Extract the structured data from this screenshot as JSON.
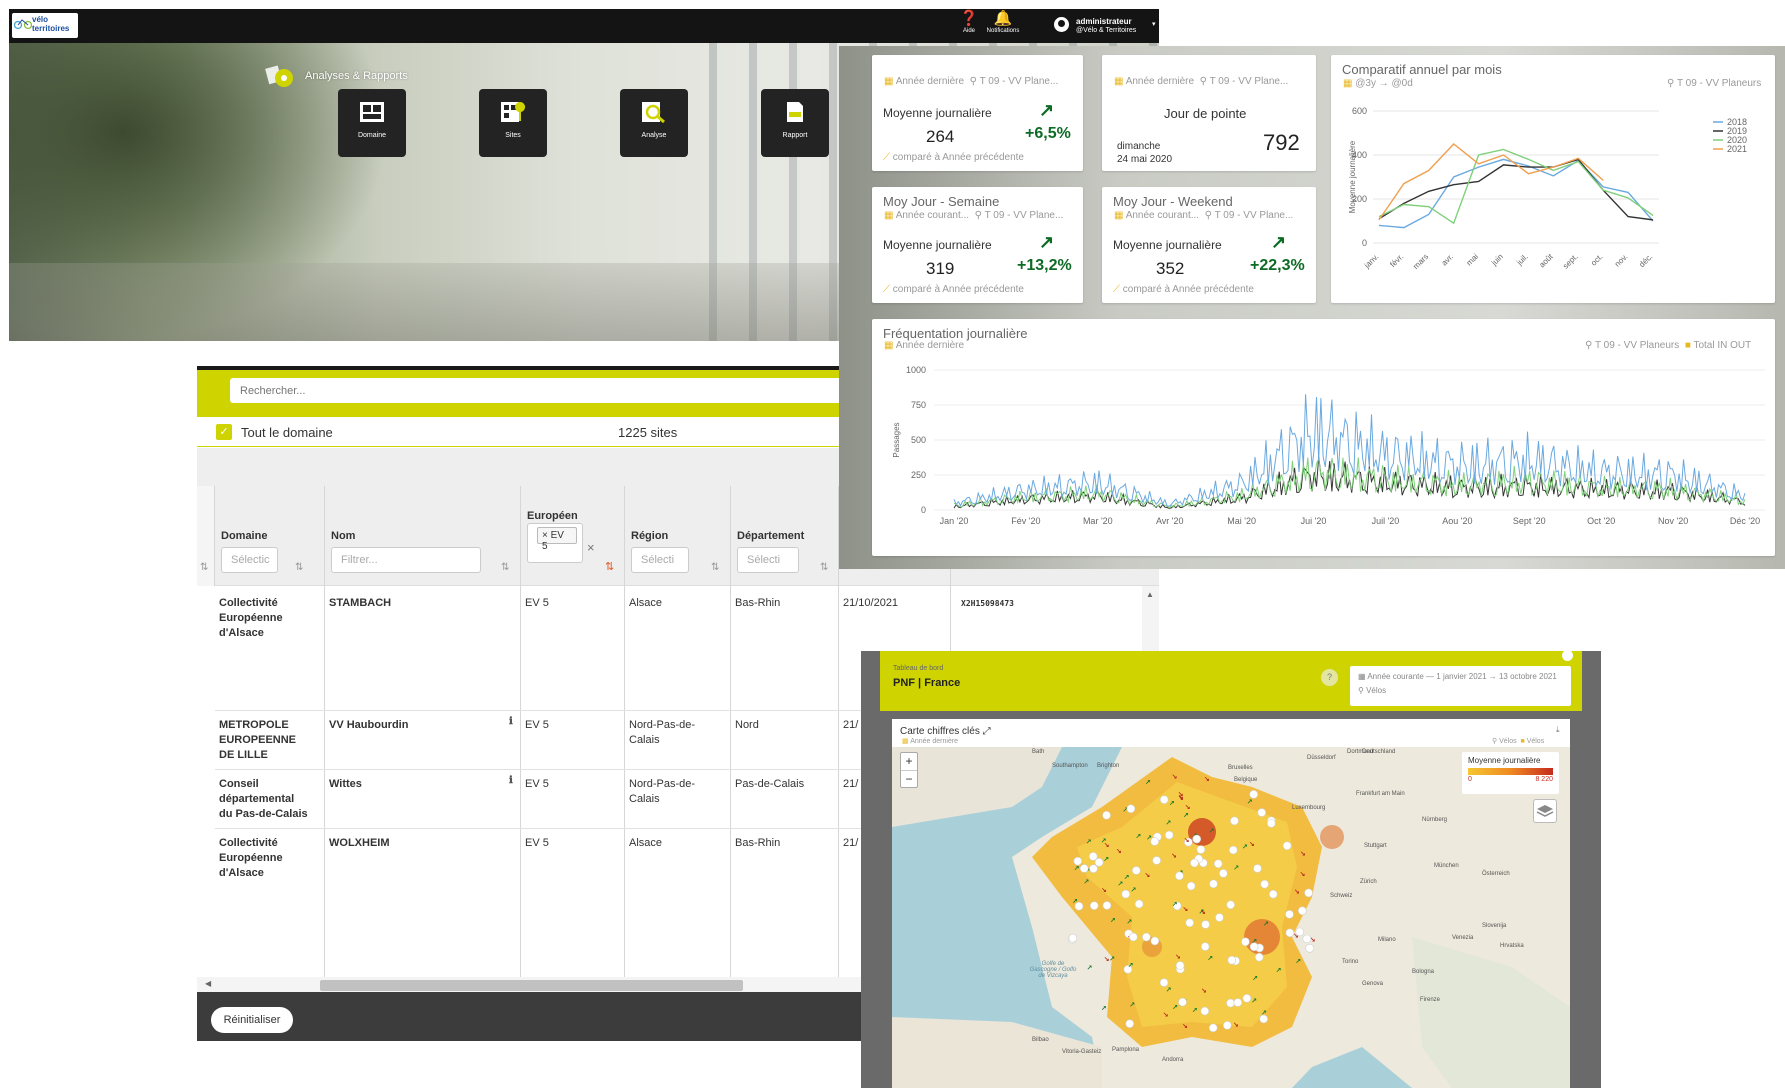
{
  "header": {
    "logo_line1": "vélo",
    "logo_line2": "territoires",
    "help_label": "Aide",
    "notif_label": "Notifications",
    "user_name": "administrateur",
    "user_org": "@Vélo & Territoires"
  },
  "hero": {
    "title": "Analyses & Rapports",
    "tiles": [
      {
        "label": "Domaine",
        "icon": "grid-icon"
      },
      {
        "label": "Sites",
        "icon": "sites-map-icon"
      },
      {
        "label": "Analyse",
        "icon": "analysis-icon"
      },
      {
        "label": "Rapport",
        "icon": "pdf-report-icon"
      }
    ]
  },
  "table_panel": {
    "search_placeholder": "Rechercher...",
    "domain_label": "Tout le domaine",
    "sites_count": "1225 sites",
    "columns": [
      {
        "label": "Domaine",
        "filter": "Sélectic"
      },
      {
        "label": "Nom",
        "filter": "Filtrer..."
      },
      {
        "label": "Européen",
        "filter": "× EV 5"
      },
      {
        "label": "Région",
        "filter": "Sélecti"
      },
      {
        "label": "Département",
        "filter": "Sélecti"
      }
    ],
    "rows": [
      {
        "domaine": [
          "Collectivité",
          "Européenne",
          "d'Alsace"
        ],
        "nom": "STAMBACH",
        "info": false,
        "europeen": "EV 5",
        "region": [
          "Alsace"
        ],
        "departement": "Bas-Rhin",
        "date": "21/10/2021",
        "serial": "X2H15098473"
      },
      {
        "domaine": [
          "METROPOLE",
          "EUROPEENNE",
          "DE LILLE"
        ],
        "nom": "VV Haubourdin",
        "info": true,
        "europeen": "EV 5",
        "region": [
          "Nord-Pas-de-",
          "Calais"
        ],
        "departement": "Nord",
        "date": "21/",
        "serial": ""
      },
      {
        "domaine": [
          "Conseil",
          "départemental",
          "du Pas-de-Calais"
        ],
        "nom": "Wittes",
        "info": true,
        "europeen": "EV 5",
        "region": [
          "Nord-Pas-de-",
          "Calais"
        ],
        "departement": "Pas-de-Calais",
        "date": "21/",
        "serial": ""
      },
      {
        "domaine": [
          "Collectivité",
          "Européenne",
          "d'Alsace"
        ],
        "nom": "WOLXHEIM",
        "info": false,
        "europeen": "EV 5",
        "region": [
          "Alsace"
        ],
        "departement": "Bas-Rhin",
        "date": "21/",
        "serial": ""
      }
    ],
    "reset_label": "Réinitialiser"
  },
  "dashboard": {
    "kpis": [
      {
        "title": "",
        "period": "Année dernière",
        "site": "T 09 - VV Plane...",
        "label": "Moyenne journalière",
        "value": "264",
        "delta": "+6,5%",
        "compare": "comparé à  Année précédente"
      },
      {
        "title": "",
        "period": "Année dernière",
        "site": "T 09 - VV Plane...",
        "label": "Jour de pointe",
        "value": "792",
        "day": "dimanche",
        "date": "24 mai 2020"
      },
      {
        "title": "Moy Jour - Semaine",
        "period": "Année courant...",
        "site": "T 09 - VV Plane...",
        "label": "Moyenne journalière",
        "value": "319",
        "delta": "+13,2%",
        "compare": "comparé à  Année précédente"
      },
      {
        "title": "Moy Jour - Weekend",
        "period": "Année courant...",
        "site": "T 09 - VV Plane...",
        "label": "Moyenne journalière",
        "value": "352",
        "delta": "+22,3%",
        "compare": "comparé à  Année précédente"
      }
    ],
    "monthly_meta": "@3y → @0d",
    "monthly_site": "T 09 - VV Planeurs",
    "daily_period": "Année dernière",
    "daily_site": "T 09 - VV Planeurs",
    "daily_series_label": "Total IN OUT"
  },
  "chart_data": [
    {
      "type": "line",
      "title": "Comparatif annuel par mois",
      "xlabel": "",
      "ylabel": "Moyenne journalière",
      "categories": [
        "janv.",
        "févr.",
        "mars",
        "avr.",
        "mai",
        "juin",
        "juil.",
        "août",
        "sept.",
        "oct.",
        "nov.",
        "déc."
      ],
      "ylim": [
        0,
        600
      ],
      "yticks": [
        0,
        200,
        400,
        600
      ],
      "legend": "right",
      "series": [
        {
          "name": "2018",
          "color": "#6aa9e0",
          "values": [
            80,
            70,
            130,
            300,
            345,
            380,
            350,
            305,
            375,
            255,
            230,
            100
          ]
        },
        {
          "name": "2019",
          "color": "#333333",
          "values": [
            110,
            180,
            235,
            265,
            280,
            355,
            345,
            345,
            380,
            240,
            120,
            105
          ]
        },
        {
          "name": "2020",
          "color": "#7fd07a",
          "values": [
            120,
            175,
            165,
            90,
            400,
            425,
            380,
            330,
            370,
            240,
            205,
            125
          ]
        },
        {
          "name": "2021",
          "color": "#f0a050",
          "values": [
            105,
            270,
            330,
            450,
            360,
            400,
            315,
            345,
            385,
            285,
            null,
            null
          ]
        }
      ]
    },
    {
      "type": "line",
      "title": "Fréquentation journalière",
      "xlabel": "",
      "ylabel": "Passages",
      "categories": [
        "Jan '20",
        "Fév '20",
        "Mar '20",
        "Avr '20",
        "Mai '20",
        "Jui '20",
        "Juil '20",
        "Aou '20",
        "Sept '20",
        "Oct '20",
        "Nov '20",
        "Déc '20"
      ],
      "ylim": [
        0,
        1000
      ],
      "yticks": [
        0,
        250,
        500,
        750,
        1000
      ],
      "series": [
        {
          "name": "Total IN OUT",
          "color": "#6aa9e0",
          "values": [
            60,
            170,
            230,
            50,
            220,
            680,
            470,
            380,
            420,
            320,
            300,
            120
          ]
        },
        {
          "name": "",
          "color": "#7fd07a",
          "values": [
            40,
            110,
            140,
            30,
            120,
            320,
            260,
            210,
            240,
            190,
            170,
            80
          ]
        },
        {
          "name": "",
          "color": "#333333",
          "values": [
            30,
            90,
            120,
            20,
            100,
            300,
            230,
            190,
            200,
            170,
            160,
            70
          ]
        }
      ]
    }
  ],
  "map_panel": {
    "small_label": "Tableau de bord",
    "title": "PNF | France",
    "help": "?",
    "period": "Année courante  —  1 janvier 2021 → 13 octobre 2021",
    "filter": "Vélos",
    "card_title": "Carte chiffres clés",
    "card_sub": "Année dernière",
    "card_legend_a": "Vélos",
    "card_legend_b": "Vélos",
    "legend_title": "Moyenne journalière",
    "legend_min": "0",
    "legend_max": "8 220",
    "places": [
      "Bath",
      "Southampton",
      "Brighton",
      "Bruxelles",
      "Düsseldorf",
      "Dortmund",
      "Frankfurt am Main",
      "Nürnberg",
      "München",
      "Österreich",
      "Schweiz",
      "Zürich",
      "Milano",
      "Torino",
      "Genova",
      "Bologna",
      "Firenze",
      "Golfe de Gascogne / Golfo de Vizcaya",
      "Bilbao",
      "Vitoria-Gasteiz",
      "Andorra",
      "Hrvatska",
      "Slovenija",
      "Luxembourg",
      "Belgique",
      "Stuttgart",
      "Venezia",
      "Pamplona",
      "Deutschland"
    ]
  }
}
